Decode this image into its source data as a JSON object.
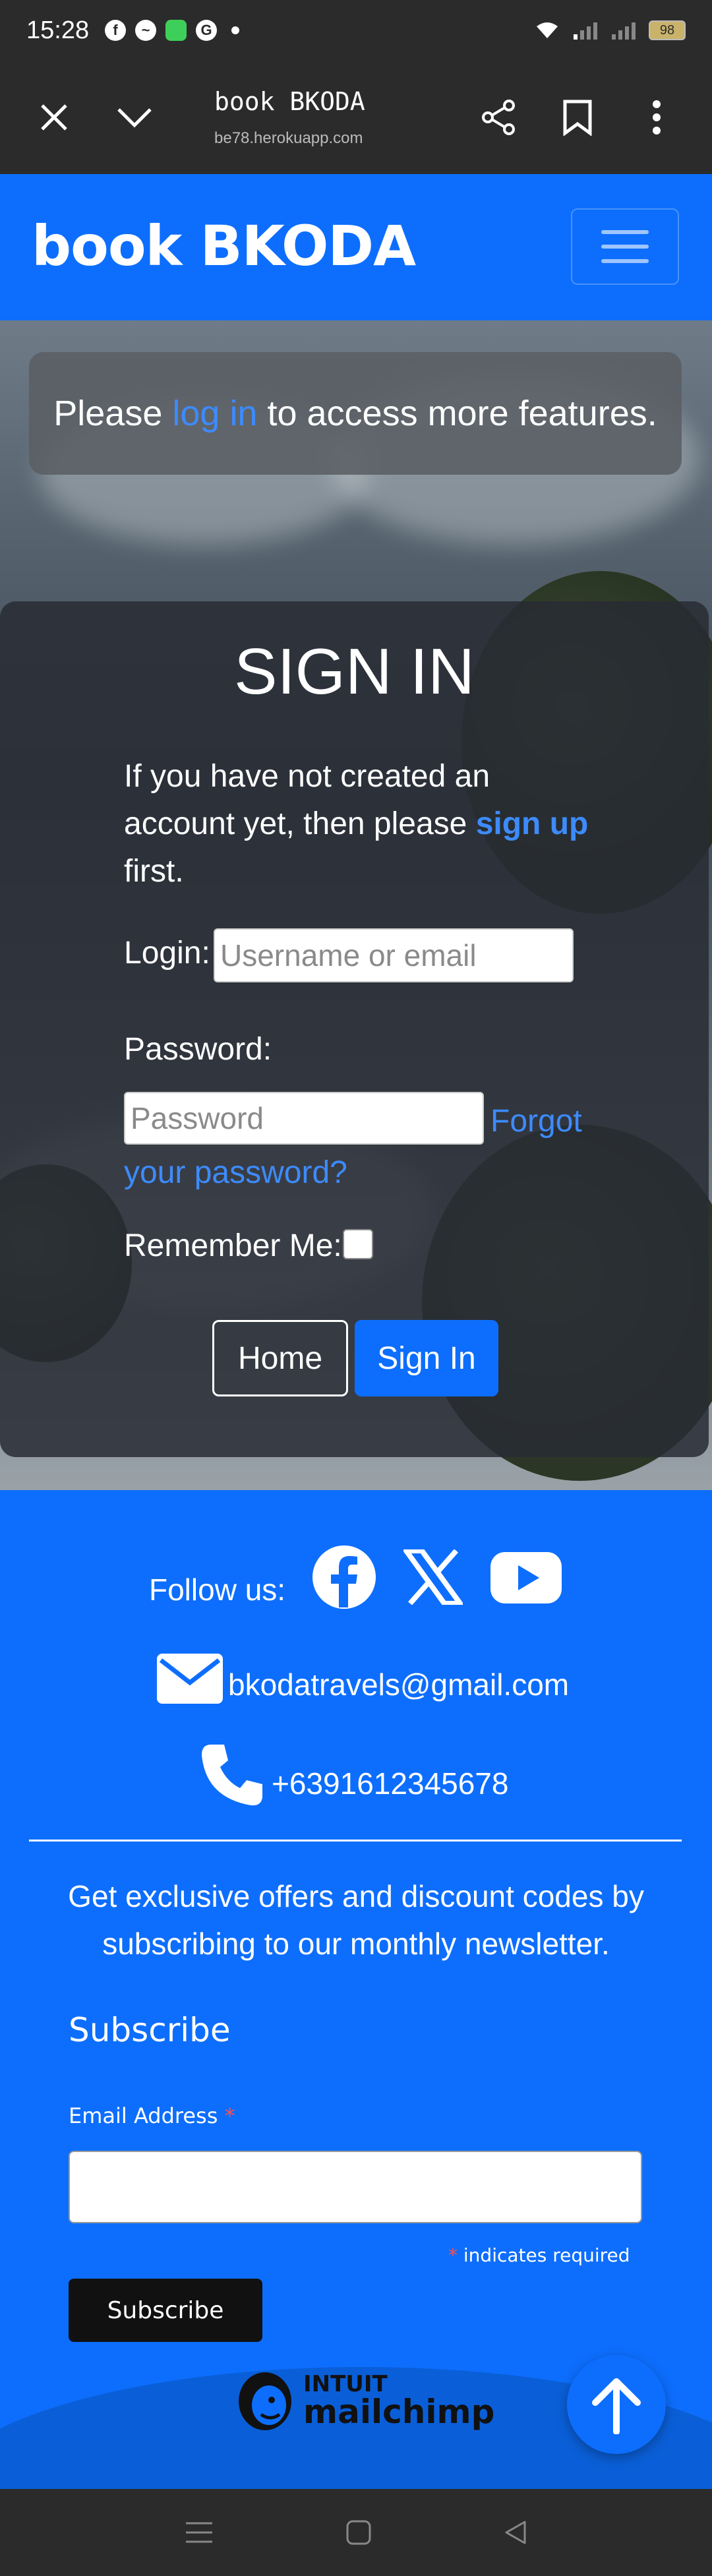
{
  "status_bar": {
    "time": "15:28",
    "battery": "98"
  },
  "browser": {
    "title": "book BKODA",
    "url": "be78.herokuapp.com"
  },
  "navbar": {
    "brand": "book BKODA"
  },
  "alert": {
    "before": "Please ",
    "link": "log in",
    "after": " to access more features."
  },
  "signin": {
    "heading": "SIGN IN",
    "intro_before": "If you have not created an account yet, then please ",
    "intro_link": "sign up",
    "intro_after": " first.",
    "login_label": "Login:",
    "login_placeholder": "Username or email",
    "password_label": "Password:",
    "password_placeholder": "Password",
    "forgot_link": "Forgot your password?",
    "remember_label": "Remember Me:",
    "home_button": "Home",
    "signin_button": "Sign In"
  },
  "footer": {
    "follow_label": "Follow us:",
    "email": "bkodatravels@gmail.com",
    "phone": "+6391612345678",
    "newsletter_text": "Get exclusive offers and discount codes by subscribing to our monthly newsletter.",
    "subscribe_title": "Subscribe",
    "email_label": "Email Address",
    "required_mark": "*",
    "required_note": "indicates required",
    "subscribe_button": "Subscribe",
    "mailchimp_top": "INTUIT",
    "mailchimp_bottom": "mailchimp"
  },
  "colors": {
    "primary": "#0d6efd",
    "link": "#3d8bfd",
    "dark": "#2b2b2b"
  },
  "icons": [
    "close-icon",
    "chevron-down-icon",
    "share-icon",
    "bookmark-icon",
    "more-icon",
    "facebook-icon",
    "x-icon",
    "youtube-icon",
    "envelope-icon",
    "phone-icon",
    "arrow-up-icon",
    "menu-icon",
    "home-icon",
    "back-icon"
  ]
}
